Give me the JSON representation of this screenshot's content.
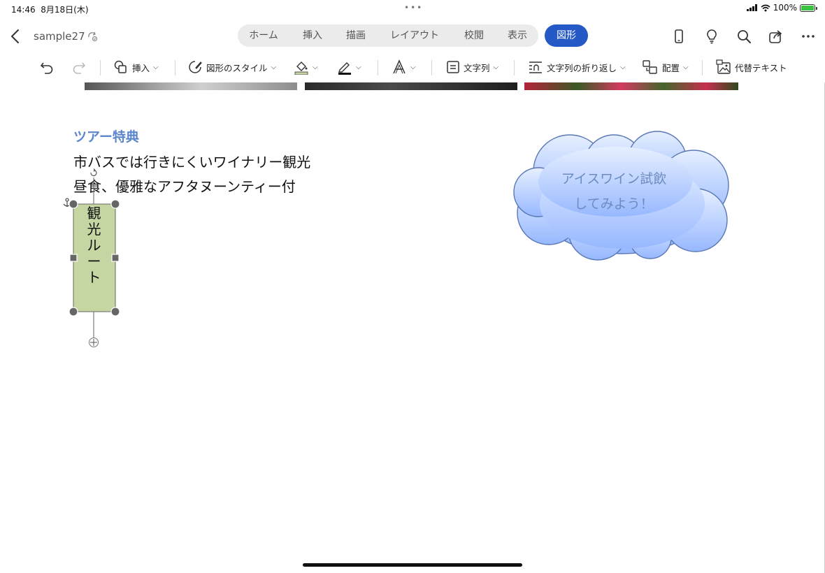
{
  "status": {
    "time": "14:46",
    "date": "8月18日(木)",
    "battery": "100%"
  },
  "header": {
    "doc_name": "sample27",
    "tabs": [
      "ホーム",
      "挿入",
      "描画",
      "レイアウト",
      "校閲",
      "表示"
    ],
    "active_tab": "図形",
    "icons": [
      "phone-view-icon",
      "lightbulb-icon",
      "search-icon",
      "share-icon",
      "more-icon"
    ]
  },
  "ribbon": {
    "insert": "挿入",
    "shape_style": "図形のスタイル",
    "text_columns": "文字列",
    "text_wrap": "文字列の折り返し",
    "arrange": "配置",
    "alt_text": "代替テキスト"
  },
  "document": {
    "heading": "ツアー特典",
    "line1": "市バスでは行きにくいワイナリー観光",
    "line2": "昼食、優雅なアフタヌーンティー付",
    "vertical_box": "観光ルート",
    "cloud_line1": "アイスワイン試飲",
    "cloud_line2": "してみよう！"
  },
  "colors": {
    "accent": "#2459c6",
    "heading": "#5b86cc",
    "box_fill": "#c6d6a3",
    "cloud_fill": "#b3cbff"
  }
}
